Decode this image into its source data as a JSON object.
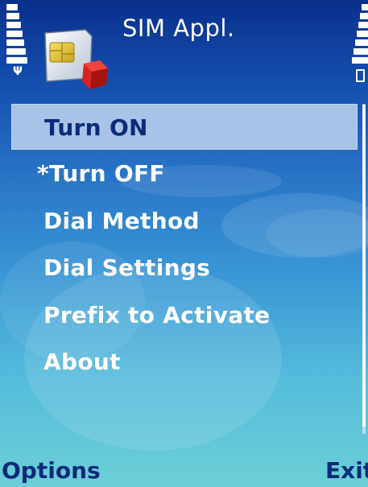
{
  "status": {
    "signal_icon": "signal-bars-icon",
    "antenna_icon": "antenna-icon",
    "antenna_glyph": "Ψ",
    "battery_icon": "battery-icon"
  },
  "header": {
    "title": "SIM Appl.",
    "app_icon": "sim-card-icon"
  },
  "menu": {
    "items": [
      {
        "label": "Turn ON",
        "selected": true
      },
      {
        "label": "*Turn OFF",
        "selected": false
      },
      {
        "label": "Dial Method",
        "selected": false
      },
      {
        "label": "Dial Settings",
        "selected": false
      },
      {
        "label": "Prefix to Activate",
        "selected": false
      },
      {
        "label": "About",
        "selected": false
      }
    ]
  },
  "softkeys": {
    "left": "Options",
    "right": "Exit"
  },
  "colors": {
    "selected_bg": "#a9c2e7",
    "selected_text": "#0b2b7a",
    "softkey_text": "#0b2b7a",
    "background_top": "#0a2f8c",
    "background_bottom": "#6ccfd6"
  }
}
